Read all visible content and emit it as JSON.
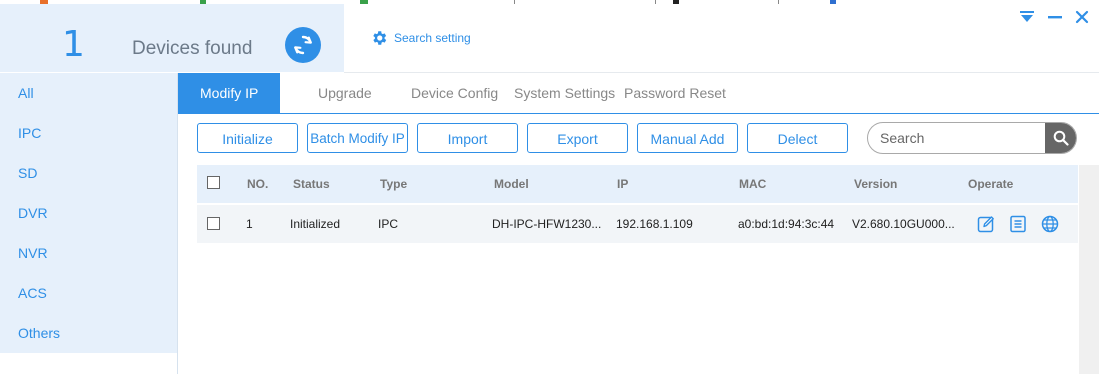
{
  "header": {
    "device_count": "1",
    "devices_found_label": "Devices found",
    "search_setting_label": "Search setting"
  },
  "sidebar": {
    "items": [
      {
        "label": "All"
      },
      {
        "label": "IPC"
      },
      {
        "label": "SD"
      },
      {
        "label": "DVR"
      },
      {
        "label": "NVR"
      },
      {
        "label": "ACS"
      },
      {
        "label": "Others"
      }
    ]
  },
  "tabs": [
    {
      "label": "Modify IP",
      "active": true
    },
    {
      "label": "Upgrade"
    },
    {
      "label": "Device Config"
    },
    {
      "label": "System Settings"
    },
    {
      "label": "Password Reset"
    }
  ],
  "toolbar": {
    "buttons": [
      {
        "label": "Initialize"
      },
      {
        "label": "Batch Modify IP"
      },
      {
        "label": "Import"
      },
      {
        "label": "Export"
      },
      {
        "label": "Manual Add"
      },
      {
        "label": "Delect"
      }
    ],
    "search_placeholder": "Search"
  },
  "table": {
    "columns": [
      "NO.",
      "Status",
      "Type",
      "Model",
      "IP",
      "MAC",
      "Version",
      "Operate"
    ],
    "rows": [
      {
        "no": "1",
        "status": "Initialized",
        "type": "IPC",
        "model": "DH-IPC-HFW1230...",
        "ip": "192.168.1.109",
        "mac": "a0:bd:1d:94:3c:44",
        "version": "V2.680.10GU000...",
        "operate_icons": [
          "edit-icon",
          "details-icon",
          "web-icon"
        ]
      }
    ]
  },
  "colors": {
    "accent": "#2f8fe6",
    "sidebar_bg": "#e6f0fb",
    "row_bg": "#f2f5f8"
  }
}
